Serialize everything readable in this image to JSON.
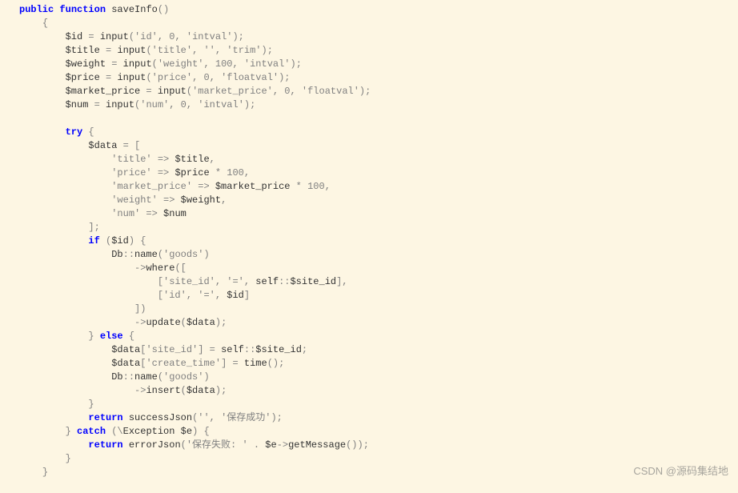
{
  "code": {
    "l1": {
      "kw1": "public",
      "kw2": "function",
      "fn": "saveInfo",
      "p": "()"
    },
    "l2": {
      "p": "{"
    },
    "l3": {
      "var": "$id",
      "eq": " = ",
      "fn": "input",
      "p1": "(",
      "s1": "'id'",
      "c1": ", ",
      "n1": "0",
      "c2": ", ",
      "s2": "'intval'",
      "p2": ");"
    },
    "l4": {
      "var": "$title",
      "eq": " = ",
      "fn": "input",
      "p1": "(",
      "s1": "'title'",
      "c1": ", ",
      "s2": "''",
      "c2": ", ",
      "s3": "'trim'",
      "p2": ");"
    },
    "l5": {
      "var": "$weight",
      "eq": " = ",
      "fn": "input",
      "p1": "(",
      "s1": "'weight'",
      "c1": ", ",
      "n1": "100",
      "c2": ", ",
      "s2": "'intval'",
      "p2": ");"
    },
    "l6": {
      "var": "$price",
      "eq": " = ",
      "fn": "input",
      "p1": "(",
      "s1": "'price'",
      "c1": ", ",
      "n1": "0",
      "c2": ", ",
      "s2": "'floatval'",
      "p2": ");"
    },
    "l7": {
      "var": "$market_price",
      "eq": " = ",
      "fn": "input",
      "p1": "(",
      "s1": "'market_price'",
      "c1": ", ",
      "n1": "0",
      "c2": ", ",
      "s2": "'floatval'",
      "p2": ");"
    },
    "l8": {
      "var": "$num",
      "eq": " = ",
      "fn": "input",
      "p1": "(",
      "s1": "'num'",
      "c1": ", ",
      "n1": "0",
      "c2": ", ",
      "s2": "'intval'",
      "p2": ");"
    },
    "l9": {
      "blank": " "
    },
    "l10": {
      "kw": "try",
      "p": " {"
    },
    "l11": {
      "var": "$data",
      "eq": " = ["
    },
    "l12": {
      "s": "'title'",
      "arrow": " => ",
      "var": "$title",
      "c": ","
    },
    "l13": {
      "s": "'price'",
      "arrow": " => ",
      "var": "$price",
      "op": " * ",
      "n": "100",
      "c": ","
    },
    "l14": {
      "s": "'market_price'",
      "arrow": " => ",
      "var": "$market_price",
      "op": " * ",
      "n": "100",
      "c": ","
    },
    "l15": {
      "s": "'weight'",
      "arrow": " => ",
      "var": "$weight",
      "c": ","
    },
    "l16": {
      "s": "'num'",
      "arrow": " => ",
      "var": "$num"
    },
    "l17": {
      "p": "];"
    },
    "l18": {
      "kw": "if",
      "p1": " (",
      "var": "$id",
      "p2": ") {"
    },
    "l19": {
      "cls": "Db",
      "op": "::",
      "fn": "name",
      "p1": "(",
      "s": "'goods'",
      "p2": ")"
    },
    "l20": {
      "arrow": "->",
      "fn": "where",
      "p": "(["
    },
    "l21": {
      "p1": "[",
      "s1": "'site_id'",
      "c1": ", ",
      "s2": "'='",
      "c2": ", ",
      "self": "self",
      "op": "::",
      "var": "$site_id",
      "p2": "],"
    },
    "l22": {
      "p1": "[",
      "s1": "'id'",
      "c1": ", ",
      "s2": "'='",
      "c2": ", ",
      "var": "$id",
      "p2": "]"
    },
    "l23": {
      "p": "])"
    },
    "l24": {
      "arrow": "->",
      "fn": "update",
      "p1": "(",
      "var": "$data",
      "p2": ");"
    },
    "l25": {
      "p1": "} ",
      "kw": "else",
      "p2": " {"
    },
    "l26": {
      "var": "$data",
      "p1": "[",
      "s": "'site_id'",
      "p2": "] = ",
      "self": "self",
      "op": "::",
      "var2": "$site_id",
      "p3": ";"
    },
    "l27": {
      "var": "$data",
      "p1": "[",
      "s": "'create_time'",
      "p2": "] = ",
      "fn": "time",
      "p3": "();"
    },
    "l28": {
      "cls": "Db",
      "op": "::",
      "fn": "name",
      "p1": "(",
      "s": "'goods'",
      "p2": ")"
    },
    "l29": {
      "arrow": "->",
      "fn": "insert",
      "p1": "(",
      "var": "$data",
      "p2": ");"
    },
    "l30": {
      "p": "}"
    },
    "l31": {
      "kw": "return",
      "sp": " ",
      "fn": "successJson",
      "p1": "(",
      "s1": "''",
      "c": ", ",
      "s2": "'保存成功'",
      "p2": ");"
    },
    "l32": {
      "p1": "} ",
      "kw": "catch",
      "p2": " (\\",
      "cls": "Exception",
      "sp": " ",
      "var": "$e",
      "p3": ") {"
    },
    "l33": {
      "kw": "return",
      "sp": " ",
      "fn": "errorJson",
      "p1": "(",
      "s": "'保存失败: '",
      "dot": " . ",
      "var": "$e",
      "arrow": "->",
      "fn2": "getMessage",
      "p2": "());"
    },
    "l34": {
      "p": "}"
    },
    "l35": {
      "p": "}"
    }
  },
  "watermark": "CSDN @源码集结地"
}
